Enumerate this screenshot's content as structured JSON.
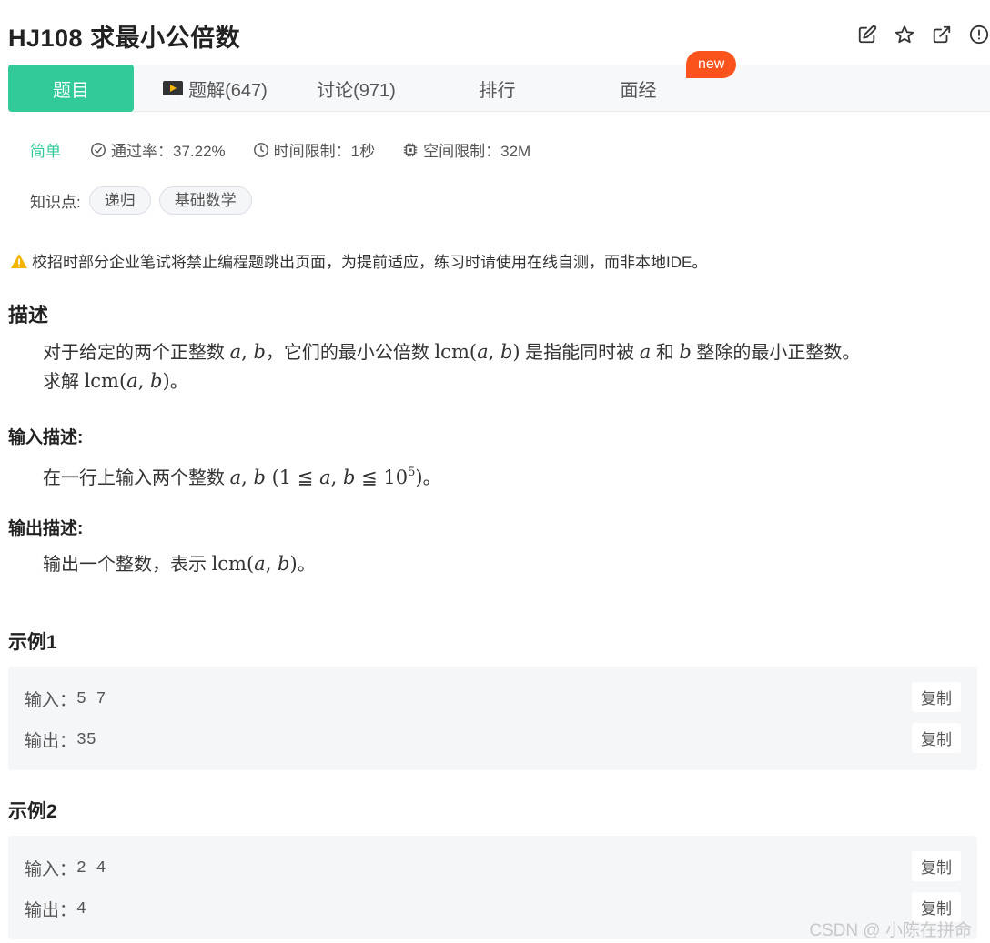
{
  "header": {
    "title": "HJ108  求最小公倍数",
    "icons": [
      "edit-icon",
      "star-icon",
      "external-link-icon",
      "info-icon"
    ]
  },
  "tabs": [
    {
      "label": "题目",
      "active": true
    },
    {
      "label": "题解(647)",
      "icon": "play-icon"
    },
    {
      "label": "讨论(971)"
    },
    {
      "label": "排行"
    },
    {
      "label": "面经"
    }
  ],
  "new_badge": "new",
  "meta": {
    "difficulty": "简单",
    "pass_rate": "通过率：37.22%",
    "time_limit": "时间限制：1秒",
    "space_limit": "空间限制：32M"
  },
  "knowledge": {
    "label": "知识点:",
    "tags": [
      "递归",
      "基础数学"
    ]
  },
  "warning": "校招时部分企业笔试将禁止编程题跳出页面，为提前适应，练习时请使用在线自测，而非本地IDE。",
  "description": {
    "heading": "描述",
    "line1_a": "对于给定的两个正整数",
    "line1_b": "，它们的最小公倍数",
    "line1_c": "是指能同时被",
    "line1_d": "和",
    "line1_e": "整除的最小正整数。",
    "line2_a": "求解",
    "line2_b": "。"
  },
  "input_desc": {
    "heading": "输入描述:",
    "text_a": "在一行上输入两个整数",
    "text_b": "。"
  },
  "output_desc": {
    "heading": "输出描述:",
    "text_a": "输出一个整数，表示",
    "text_b": "。"
  },
  "examples": [
    {
      "heading": "示例1",
      "input_label": "输入：",
      "input": "5 7",
      "output_label": "输出：",
      "output": "35",
      "copy": "复制"
    },
    {
      "heading": "示例2",
      "input_label": "输入：",
      "input": "2 4",
      "output_label": "输出：",
      "output": "4",
      "copy": "复制"
    }
  ],
  "watermark": "CSDN @  小陈在拼命",
  "colors": {
    "accent": "#32ca99",
    "badge": "#fa541c",
    "warning": "#f5b400"
  }
}
